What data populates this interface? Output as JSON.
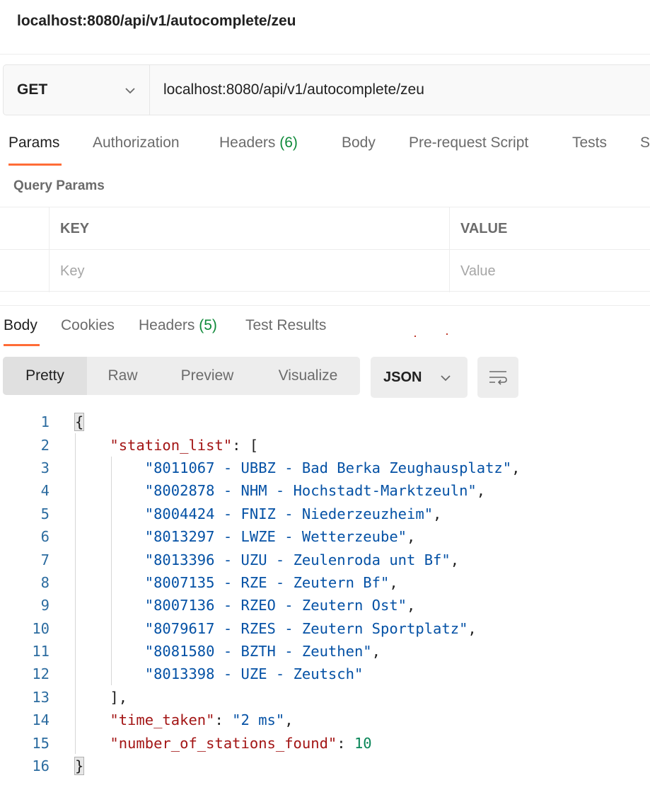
{
  "request": {
    "title": "localhost:8080/api/v1/autocomplete/zeu",
    "method": "GET",
    "url": "localhost:8080/api/v1/autocomplete/zeu"
  },
  "request_tabs": {
    "params": "Params",
    "authorization": "Authorization",
    "headers": "Headers",
    "headers_count": "(6)",
    "body": "Body",
    "prerequest": "Pre-request Script",
    "tests": "Tests",
    "settings_partial": "S"
  },
  "query_params": {
    "title": "Query Params",
    "col_key": "KEY",
    "col_value": "VALUE",
    "key_placeholder": "Key",
    "value_placeholder": "Value"
  },
  "response_tabs": {
    "body": "Body",
    "cookies": "Cookies",
    "headers": "Headers",
    "headers_count": "(5)",
    "test_results": "Test Results"
  },
  "view_modes": {
    "pretty": "Pretty",
    "raw": "Raw",
    "preview": "Preview",
    "visualize": "Visualize",
    "format": "JSON"
  },
  "response": {
    "line_numbers": [
      "1",
      "2",
      "3",
      "4",
      "5",
      "6",
      "7",
      "8",
      "9",
      "10",
      "11",
      "12",
      "13",
      "14",
      "15",
      "16"
    ],
    "station_list_key": "\"station_list\"",
    "stations": [
      "\"8011067 - UBBZ - Bad Berka Zeughausplatz\"",
      "\"8002878 - NHM - Hochstadt-Marktzeuln\"",
      "\"8004424 - FNIZ - Niederzeuzheim\"",
      "\"8013297 - LWZE - Wetterzeube\"",
      "\"8013396 - UZU - Zeulenroda unt Bf\"",
      "\"8007135 - RZE - Zeutern Bf\"",
      "\"8007136 - RZEO - Zeutern Ost\"",
      "\"8079617 - RZES - Zeutern Sportplatz\"",
      "\"8081580 - BZTH - Zeuthen\"",
      "\"8013398 - UZE - Zeutsch\""
    ],
    "time_taken_key": "\"time_taken\"",
    "time_taken_value": "\"2 ms\"",
    "number_key": "\"number_of_stations_found\"",
    "number_value": "10"
  }
}
